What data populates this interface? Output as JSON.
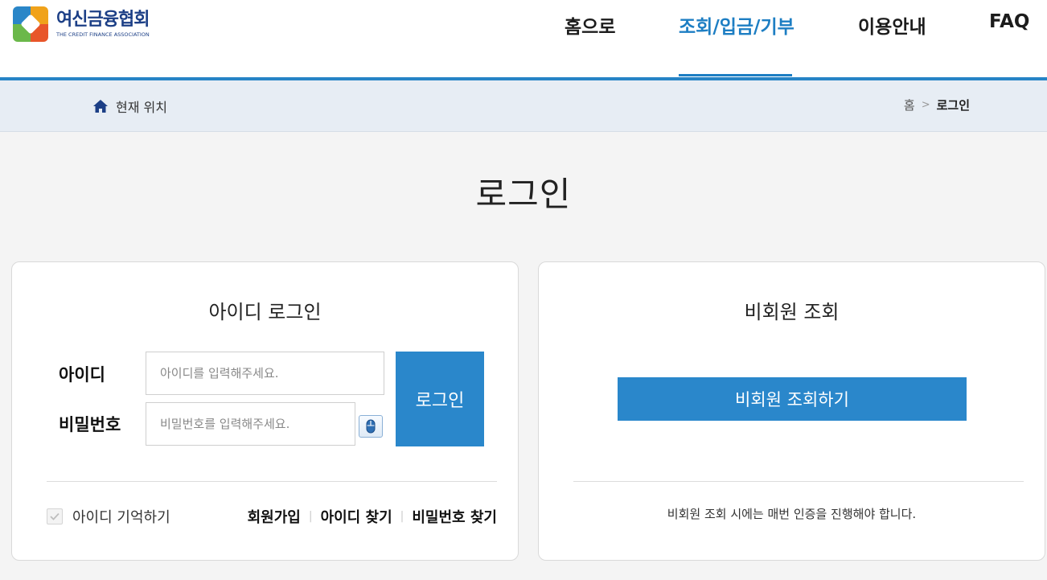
{
  "header": {
    "logo_ko": "여신금융협회",
    "logo_en": "THE CREDIT FINANCE ASSOCIATION",
    "nav": [
      {
        "label": "홈으로"
      },
      {
        "label": "조회/입금/기부"
      },
      {
        "label": "이용안내"
      },
      {
        "label": "FAQ"
      }
    ],
    "active_nav": "조회/입금/기부",
    "accent_color": "#1d7ec3"
  },
  "breadcrumb": {
    "label": "현재 위치",
    "home": "홈",
    "separator": ">",
    "current": "로그인"
  },
  "page": {
    "title": "로그인"
  },
  "id_login": {
    "title": "아이디 로그인",
    "id_label": "아이디",
    "id_placeholder": "아이디를 입력해주세요.",
    "pw_label": "비밀번호",
    "pw_placeholder": "비밀번호를 입력해주세요.",
    "login_button": "로그인",
    "remember_label": "아이디 기억하기",
    "links": {
      "signup": "회원가입",
      "find_id": "아이디 찾기",
      "find_pw": "비밀번호 찾기"
    }
  },
  "guest": {
    "title": "비회원 조회",
    "button": "비회원 조회하기",
    "note": "비회원 조회 시에는 매번 인증을 진행해야 합니다."
  }
}
